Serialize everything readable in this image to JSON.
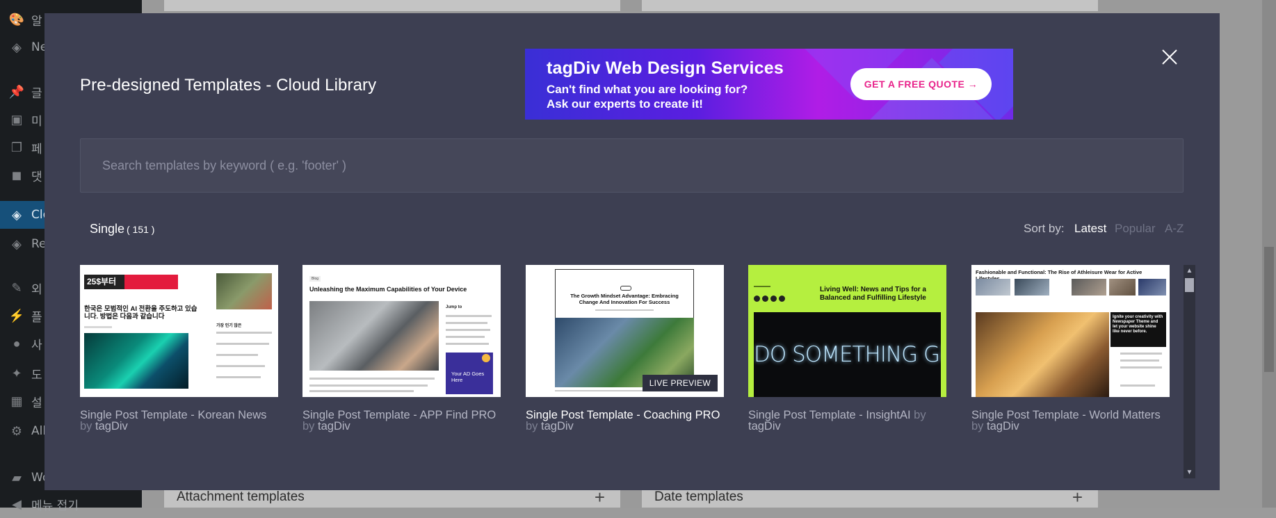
{
  "wp_sidebar": {
    "items": [
      {
        "label": "알",
        "icon": "palette-icon",
        "active": false
      },
      {
        "label": "Ne",
        "icon": "tagdiv-icon",
        "active": false
      },
      {
        "label": "글",
        "icon": "pin-icon",
        "active": false
      },
      {
        "label": "미",
        "icon": "media-icon",
        "active": false
      },
      {
        "label": "페",
        "icon": "pages-icon",
        "active": false
      },
      {
        "label": "댓",
        "icon": "comment-icon",
        "active": false
      },
      {
        "label": "Clo",
        "icon": "tagdiv-icon",
        "active": true
      },
      {
        "label": "Re",
        "icon": "tagdiv-icon",
        "active": false
      },
      {
        "label": "외",
        "icon": "brush-icon",
        "active": false
      },
      {
        "label": "플",
        "icon": "plugin-icon",
        "active": false
      },
      {
        "label": "사",
        "icon": "user-icon",
        "active": false
      },
      {
        "label": "도",
        "icon": "wrench-icon",
        "active": false
      },
      {
        "label": "설",
        "icon": "settings-icon",
        "active": false
      },
      {
        "label": "All",
        "icon": "cog-icon",
        "active": false
      },
      {
        "label": "Wo",
        "icon": "woo-icon",
        "active": false
      },
      {
        "label": "메뉴 접기",
        "icon": "collapse-icon",
        "active": false
      }
    ]
  },
  "background": {
    "rows": [
      {
        "label": "Attachment templates",
        "action": "+"
      },
      {
        "label": "Date templates",
        "action": "+"
      }
    ]
  },
  "modal": {
    "title": "Pre-designed Templates - Cloud Library",
    "close_icon": "close-icon",
    "banner": {
      "title": "tagDiv Web Design Services",
      "line1": "Can't find what you are looking for?",
      "line2": "Ask our experts to create it!",
      "cta": "GET A FREE QUOTE →"
    },
    "search": {
      "placeholder": "Search templates by keyword ( e.g. 'footer' )",
      "value": ""
    },
    "category": {
      "label": "Single",
      "count": "( 151 )"
    },
    "sort": {
      "label": "Sort by:",
      "options": [
        "Latest",
        "Popular",
        "A-Z"
      ],
      "selected": "Latest"
    },
    "templates": [
      {
        "name": "Single Post Template - Korean News",
        "by": "by",
        "author": "tagDiv",
        "thumb": {
          "badge": "25$부터",
          "headline": "한국은 모범적인 AI 전환을 주도하고 있습니다. 방법은 다음과 같습니다",
          "side_title": "가장 인기 많은"
        }
      },
      {
        "name": "Single Post Template - APP Find PRO",
        "by": "by",
        "author": "tagDiv",
        "thumb": {
          "tag": "Blog",
          "headline": "Unleashing the Maximum Capabilities of Your Device",
          "side_title": "Jump to",
          "ad_text": "Your AD Goes Here"
        }
      },
      {
        "name": "Single Post Template - Coaching PRO",
        "by": "by",
        "author": "tagDiv",
        "hover": true,
        "live_preview": "LIVE PREVIEW",
        "thumb": {
          "headline": "The Growth Mindset Advantage: Embracing Change And Innovation For Success"
        }
      },
      {
        "name": "Single Post Template - InsightAI",
        "by": "by",
        "author": "tagDiv",
        "thumb": {
          "headline": "Living Well: News and Tips for a Balanced and Fulfilling Lifestyle",
          "neon": "DO SOMETHING GREAT"
        }
      },
      {
        "name": "Single Post Template - World Matters",
        "by": "by",
        "author": "tagDiv",
        "thumb": {
          "headline": "Fashionable and Functional: The Rise of Athleisure Wear for Active Lifestyles",
          "box_text": "Ignite your creativity with Newspaper Theme and let your website shine like never before."
        }
      }
    ]
  },
  "colors": {
    "modal_bg": "#3d3f52",
    "accent_pink": "#e8228a",
    "sidebar_active": "#16507a",
    "lime": "#b5ef3f"
  }
}
